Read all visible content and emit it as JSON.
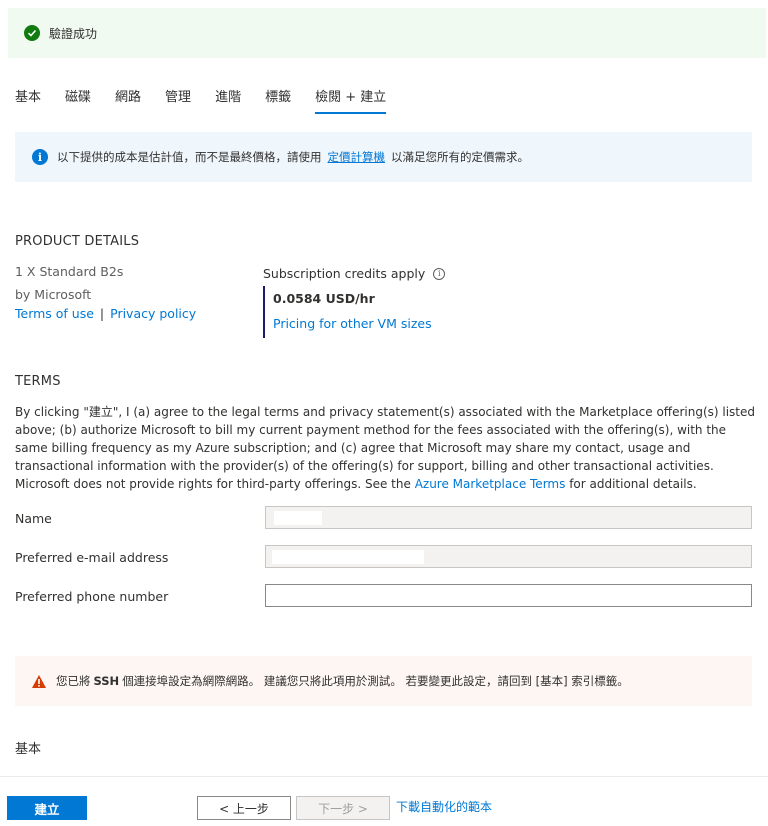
{
  "success": {
    "message": "驗證成功",
    "color": "#107c10"
  },
  "tabs": [
    {
      "label": "基本"
    },
    {
      "label": "磁碟"
    },
    {
      "label": "網路"
    },
    {
      "label": "管理"
    },
    {
      "label": "進階"
    },
    {
      "label": "標籤"
    },
    {
      "label": "檢閱 + 建立",
      "active": true
    }
  ],
  "info_banner": {
    "before": "以下提供的成本是估計值，而不是最終價格，請使用",
    "link": "定價計算機",
    "after": "以滿足您所有的定價需求。"
  },
  "product": {
    "heading": "PRODUCT DETAILS",
    "name": "1 X Standard B2s",
    "by": "by Microsoft",
    "terms_link": "Terms of use",
    "separator": "|",
    "privacy_link": "Privacy policy",
    "credits": "Subscription credits apply",
    "price": "0.0584 USD/hr",
    "pricing_link": "Pricing for other VM sizes"
  },
  "terms": {
    "heading": "TERMS",
    "text_before": "By clicking \"建立\", I (a) agree to the legal terms and privacy statement(s) associated with the Marketplace offering(s) listed above; (b) authorize Microsoft to bill my current payment method for the fees associated with the offering(s), with the same billing frequency as my Azure subscription; and (c) agree that Microsoft may share my contact, usage and transactional information with the provider(s) of the offering(s) for support, billing and other transactional activities. Microsoft does not provide rights for third-party offerings. See the",
    "link": "Azure Marketplace Terms",
    "text_after": "for additional details."
  },
  "form": {
    "name_label": "Name",
    "name_value": "",
    "email_label": "Preferred e-mail address",
    "email_value": "",
    "phone_label": "Preferred phone number",
    "phone_value": ""
  },
  "warning": {
    "text_before": "您已將",
    "bold": "SSH",
    "text_after": "個連接埠設定為網際網路。 建議您只將此項用於測試。 若要變更此設定，請回到 [基本] 索引標籤。",
    "color": "#d83b01"
  },
  "basics": {
    "heading": "基本"
  },
  "footer": {
    "create": "建立",
    "prev": "< 上一步",
    "next": "下一步 >",
    "download": "下載自動化的範本"
  },
  "colors": {
    "accent": "#0078d4",
    "info_bg": "#eff6fc",
    "warn_bg": "#fdf6f3"
  }
}
